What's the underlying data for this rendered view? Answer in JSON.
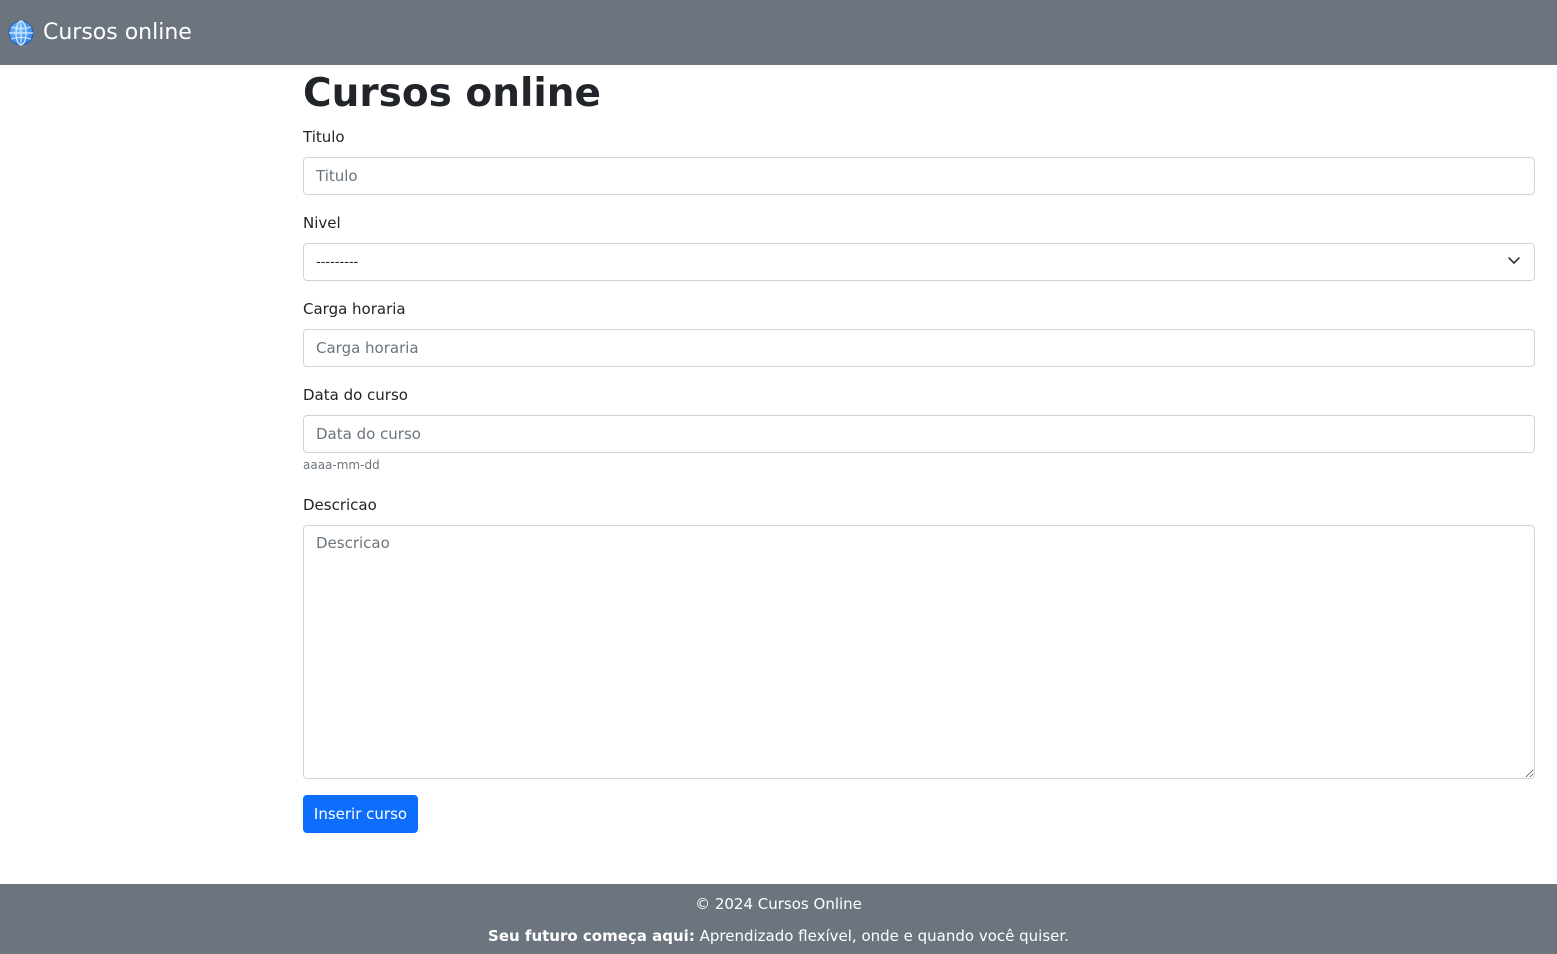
{
  "navbar": {
    "brand_icon": "globe-icon",
    "brand_text": "Cursos online"
  },
  "main": {
    "title": "Cursos online",
    "fields": {
      "titulo": {
        "label": "Titulo",
        "placeholder": "Titulo"
      },
      "nivel": {
        "label": "Nivel",
        "selected": "---------"
      },
      "carga_horaria": {
        "label": "Carga horaria",
        "placeholder": "Carga horaria"
      },
      "data_curso": {
        "label": "Data do curso",
        "placeholder": "Data do curso",
        "help": "aaaa-mm-dd"
      },
      "descricao": {
        "label": "Descricao",
        "placeholder": "Descricao"
      }
    },
    "submit_label": "Inserir curso"
  },
  "footer": {
    "copyright": "© 2024 Cursos Online",
    "tagline_strong": "Seu futuro começa aqui:",
    "tagline_text": " Aprendizado flexível, onde e quando você quiser."
  },
  "colors": {
    "navbar_bg": "#6c757d",
    "primary": "#0d6efd",
    "border": "#ced4da"
  }
}
